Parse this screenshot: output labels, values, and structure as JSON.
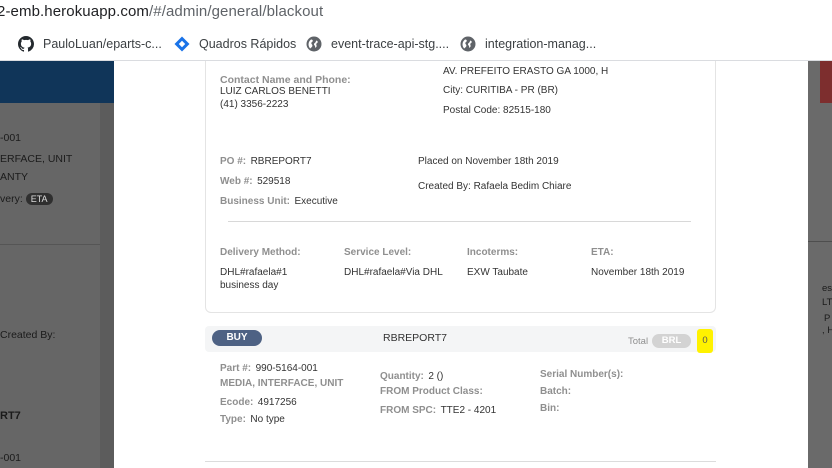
{
  "browser": {
    "url_host": "2-emb.herokuapp.com",
    "url_path": "/#/admin/general/blackout",
    "bookmarks": [
      {
        "icon": "github-icon",
        "label": "PauloLuan/eparts-c..."
      },
      {
        "icon": "diamond-icon",
        "label": "Quadros Rápidos"
      },
      {
        "icon": "globe-icon",
        "label": "event-trace-api-stg...."
      },
      {
        "icon": "globe-icon",
        "label": "integration-manag..."
      }
    ]
  },
  "background": {
    "left_lines": [
      "-001",
      "ERFACE, UNIT",
      "ANTY",
      "very:"
    ],
    "eta_badge": "ETA",
    "created_by": "Created By:",
    "rt7": "RT7",
    "bottom_line": "-001",
    "right_lines": [
      "ess",
      "LT",
      "P",
      ", H"
    ]
  },
  "order": {
    "contact_label": "Contact Name and Phone:",
    "contact_name": "LUIZ CARLOS BENETTI",
    "contact_phone": "(41) 3356-2223",
    "address_line": "AV. PREFEITO ERASTO GA 1000, H",
    "city_label": "City:",
    "city": "CURITIBA - PR (BR)",
    "postal_label": "Postal Code:",
    "postal": "82515-180",
    "po_label": "PO #:",
    "po": "RBREPORT7",
    "web_label": "Web #:",
    "web": "529518",
    "bu_label": "Business Unit:",
    "bu": "Executive",
    "placed_on": "Placed on November 18th 2019",
    "created_by": "Created By: Rafaela Bedim Chiare",
    "delivery_label": "Delivery Method:",
    "delivery_value_1": "DHL#rafaela#1",
    "delivery_value_2": "business day",
    "service_label": "Service Level:",
    "service_value": "DHL#rafaela#Via DHL",
    "incoterms_label": "Incoterms:",
    "incoterms_value": "EXW Taubate",
    "eta_label": "ETA:",
    "eta_value": "November 18th 2019"
  },
  "item": {
    "buy_label": "BUY",
    "reference": "RBREPORT7",
    "total_label": "Total",
    "currency": "BRL",
    "total_value": "0",
    "part_label": "Part #:",
    "part": "990-5164-001",
    "description": "MEDIA, INTERFACE, UNIT",
    "ecode_label": "Ecode:",
    "ecode": "4917256",
    "type_label": "Type:",
    "type": "No type",
    "quantity_label": "Quantity:",
    "quantity": "2 ()",
    "product_class_label": "FROM Product Class:",
    "spc_label": "FROM SPC:",
    "spc": "TTE2 - 4201",
    "serial_label": "Serial Number(s):",
    "batch_label": "Batch:",
    "bin_label": "Bin:"
  },
  "colors": {
    "buy_button": "#4e6284",
    "highlight": "#fff200",
    "overlay": "#5c5c5c",
    "header_band": "#103559"
  }
}
